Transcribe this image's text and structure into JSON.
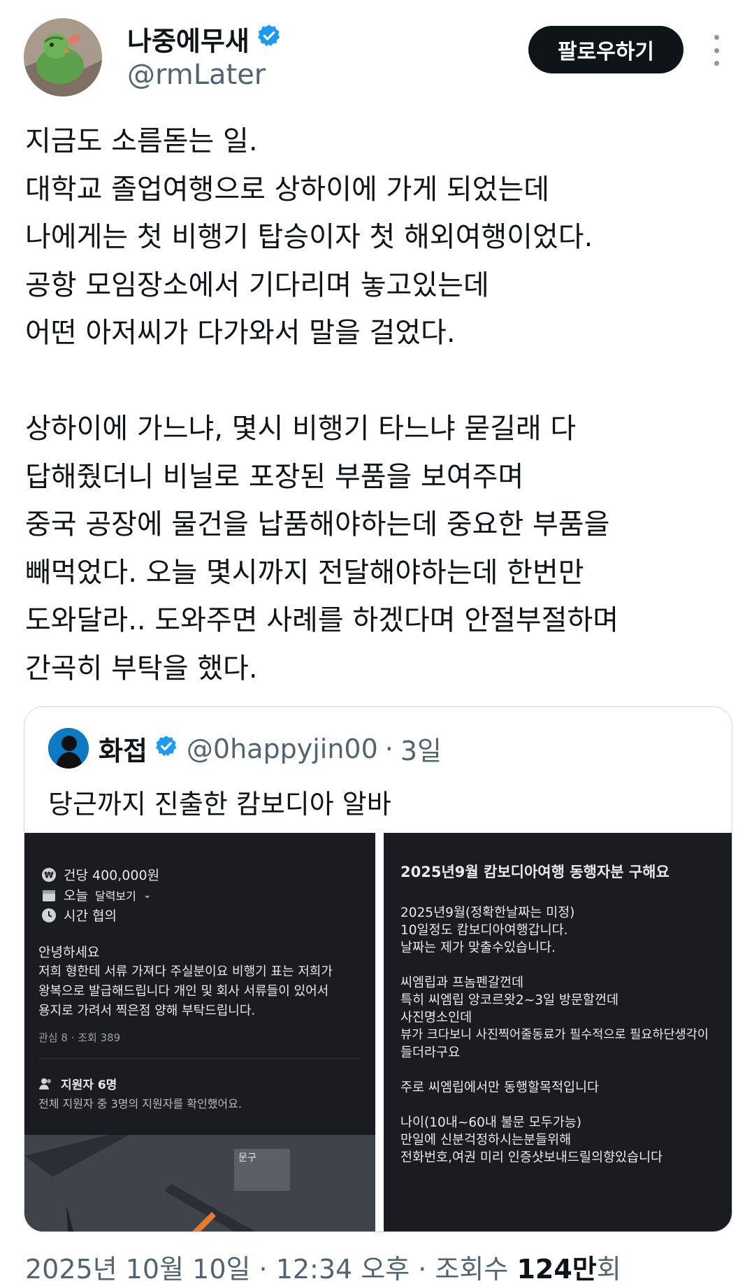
{
  "author": {
    "display_name": "나중에무새",
    "handle": "@rmLater",
    "verified": true,
    "follow_label": "팔로우하기"
  },
  "tweet": {
    "lines": [
      "지금도 소름돋는 일.",
      "대학교 졸업여행으로 상하이에 가게 되었는데",
      "나에게는 첫 비행기 탑승이자 첫 해외여행이었다.",
      "공항 모임장소에서 기다리며 놓고있는데",
      "어떤 아저씨가 다가와서 말을 걸었다.",
      "",
      "상하이에 가느냐, 몇시 비행기 타느냐 묻길래 다",
      "답해줬더니 비닐로 포장된 부품을 보여주며",
      "중국 공장에 물건을 납품해야하는데 중요한 부품을",
      "빼먹었다. 오늘 몇시까지 전달해야하는데 한번만",
      "도와달라.. 도와주면 사례를 하겠다며 안절부절하며",
      "간곡히 부탁을 했다."
    ]
  },
  "quote": {
    "name": "화접",
    "handle": "@0happyjin00",
    "separator": "·",
    "time": "3일",
    "text": "당근까지 진출한 캄보디아 알바",
    "left_image": {
      "price": "건당 400,000원",
      "date": "오늘",
      "calendar": "달력보기",
      "time": "시간 협의",
      "body": [
        "안녕하세요",
        "저희 형한테 서류 가져다 주실분이요 비행기 표는 저희가",
        "왕복으로 발급해드립니다 개인 및 회사 서류들이 있어서",
        "용지로 가려서 찍은점 양해 부탁드립니다."
      ],
      "stats": "관심 8 · 조회 389",
      "applicants_title": "지원자 6명",
      "applicants_note": "전체 지원자 중 3명의 지원자를 확인했어요.",
      "map_label": "문구"
    },
    "right_image": {
      "title": "2025년9월 캄보디아여행 동행자분 구해요",
      "lines": [
        "2025년9월(정확한날짜는 미정)",
        "10일정도 캄보디아여행갑니다.",
        "날짜는 제가 맞출수있습니다.",
        "",
        "씨엠립과 프놈펜갈껀데",
        "특히 씨엠립 앙코르왓2~3일 방문할껀데",
        "사진명소인데",
        "뷰가 크다보니 사진찍어줄동료가 필수적으로 필요하단생각이",
        "들더라구요",
        "",
        "주로 씨엠립에서만 동행할목적입니다",
        "",
        "나이(10내~60내 불문 모두가능)",
        "만일에 신분걱정하시는분들위해",
        "전화번호,여권 미리 인증샷보내드릴의향있습니다"
      ]
    }
  },
  "footer": {
    "date": "2025년 10월 10일",
    "sep1": " · ",
    "time": "12:34 오후",
    "sep2": " · ",
    "views_label": "조회수 ",
    "views_count": "124만",
    "views_suffix": "회"
  },
  "colors": {
    "verified": "#1d9bf0",
    "muted": "#536471",
    "follow_bg": "#0f1419",
    "media_bg": "#1a1c21"
  }
}
